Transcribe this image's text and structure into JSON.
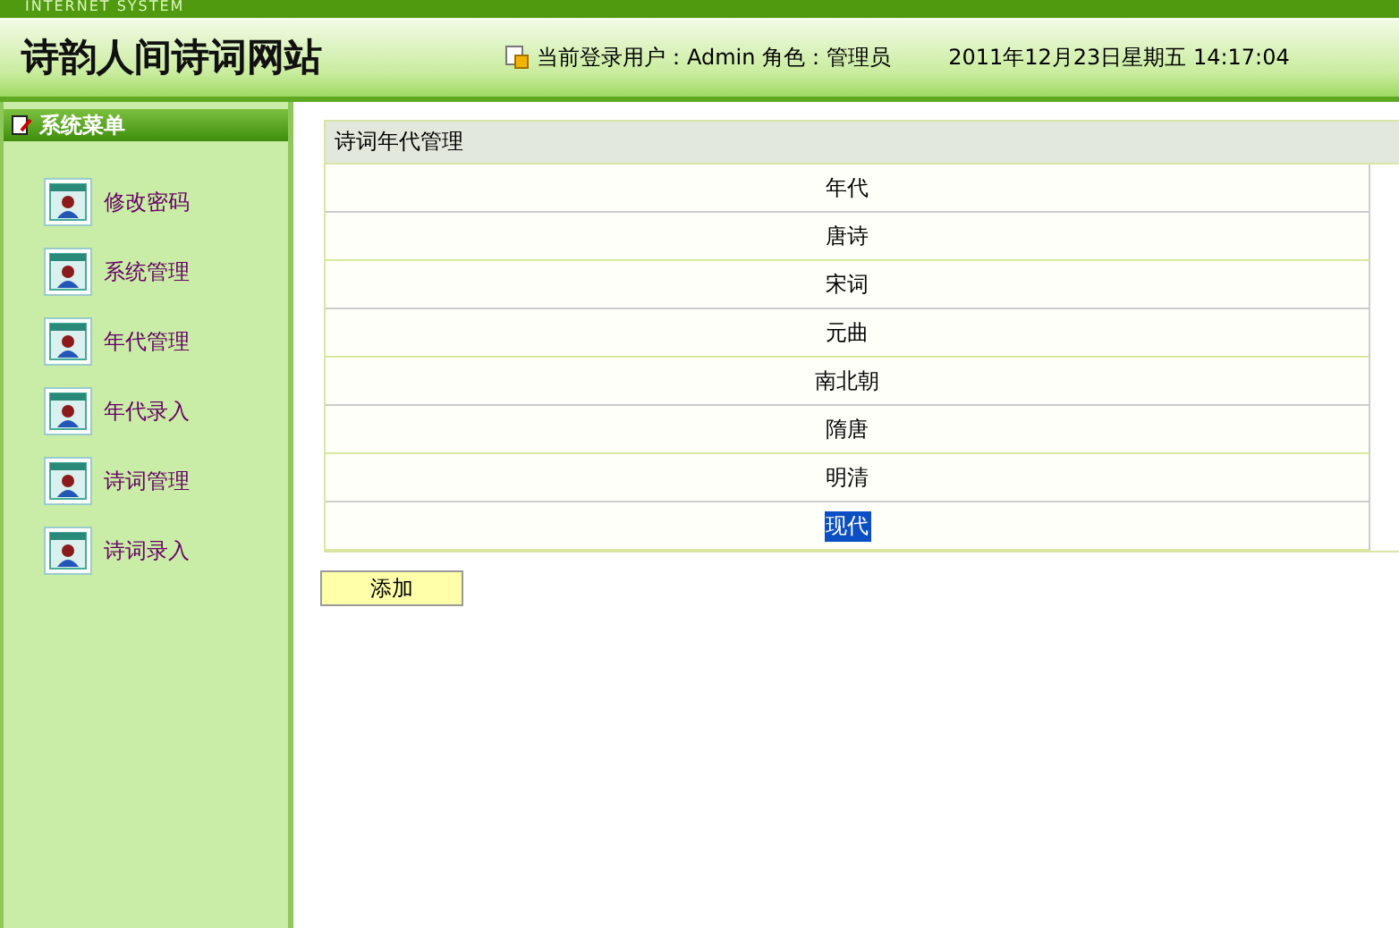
{
  "header": {
    "tagline": "INTERNET SYSTEM",
    "title": "诗韵人间诗词网站",
    "user_info": "当前登录用户：Admin 角色：管理员",
    "datetime": "2011年12月23日星期五  14:17:04"
  },
  "sidebar": {
    "title": "系统菜单",
    "items": [
      {
        "label": "修改密码"
      },
      {
        "label": "系统管理"
      },
      {
        "label": "年代管理"
      },
      {
        "label": "年代录入"
      },
      {
        "label": "诗词管理"
      },
      {
        "label": "诗词录入"
      }
    ]
  },
  "table": {
    "title": "诗词年代管理",
    "column": "年代",
    "rows": [
      {
        "value": "唐诗",
        "selected": false
      },
      {
        "value": "宋词",
        "selected": false
      },
      {
        "value": "元曲",
        "selected": false
      },
      {
        "value": "南北朝",
        "selected": false
      },
      {
        "value": "隋唐",
        "selected": false
      },
      {
        "value": "明清",
        "selected": false
      },
      {
        "value": "现代",
        "selected": true
      }
    ]
  },
  "buttons": [
    "添加"
  ]
}
